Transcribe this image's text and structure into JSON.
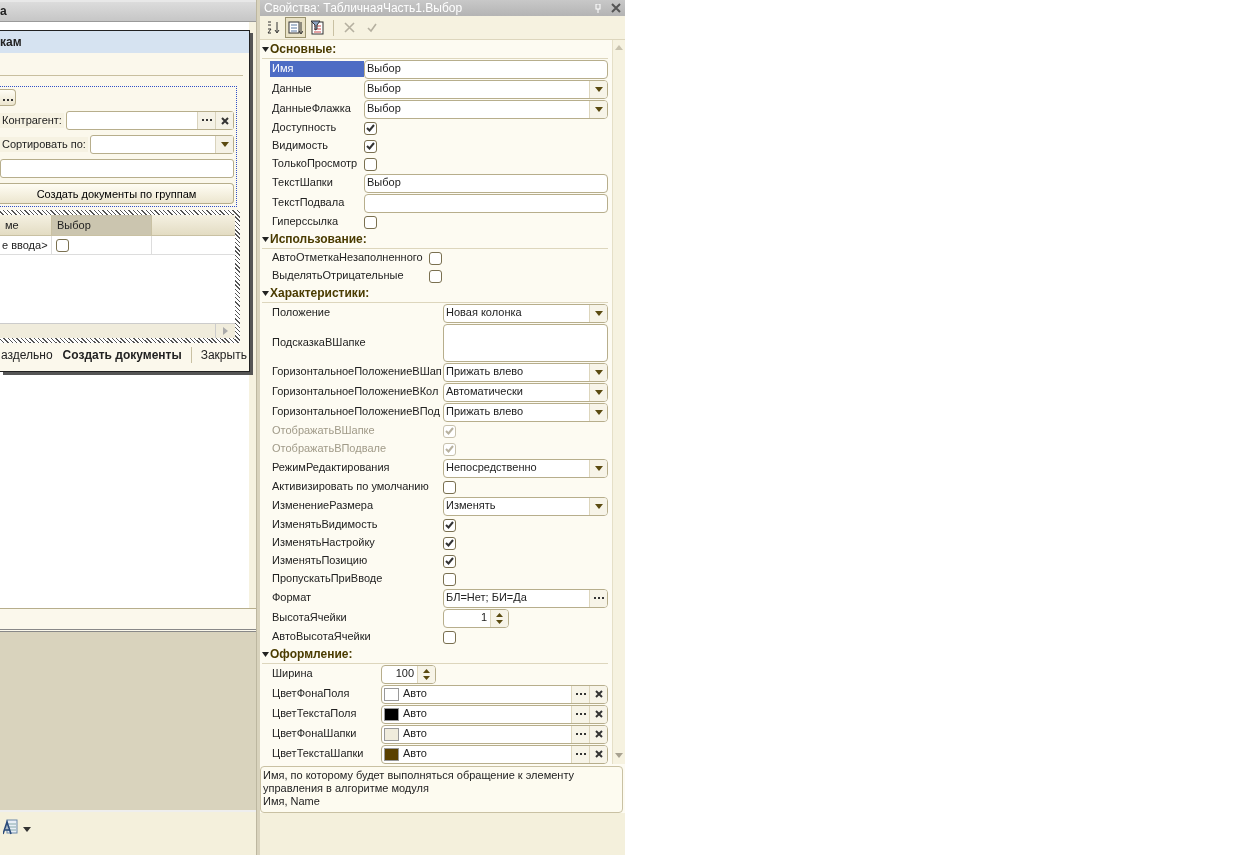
{
  "designer": {
    "title": "а",
    "form": {
      "title": "кам",
      "fields": [
        {
          "kind": "choice",
          "label": "Контрагент:"
        },
        {
          "kind": "select",
          "label": "Сортировать по:"
        },
        {
          "kind": "text"
        }
      ],
      "action_button": "Создать документы по группам",
      "table": {
        "columns": [
          {
            "title": "ме",
            "selected": false
          },
          {
            "title": "Выбор",
            "selected": true
          }
        ],
        "rows": [
          {
            "text": "е ввода>",
            "checked": false
          }
        ]
      },
      "buttons": [
        {
          "label": "аздельно",
          "default": false
        },
        {
          "label": "Создать документы",
          "default": true
        },
        {
          "label": "Закрыть",
          "default": false
        }
      ]
    }
  },
  "properties": {
    "title": "Свойства: ТабличнаяЧасть1.Выбор",
    "toolbar": [
      {
        "kind": "sort",
        "pressed": false,
        "disabled": false
      },
      {
        "kind": "categories",
        "pressed": true,
        "disabled": false
      },
      {
        "kind": "filter",
        "pressed": false,
        "disabled": false
      },
      {
        "kind": "delete",
        "pressed": false,
        "disabled": true
      },
      {
        "kind": "apply",
        "pressed": false,
        "disabled": true
      }
    ],
    "groups": [
      {
        "title": "Основные:",
        "expanded": true,
        "items": [
          {
            "label": "Имя",
            "kind": "text",
            "value": "Выбор",
            "selected": true
          },
          {
            "label": "Данные",
            "kind": "select",
            "value": "Выбор",
            "selected": false
          },
          {
            "label": "ДанныеФлажка",
            "kind": "select",
            "value": "Выбор",
            "selected": false
          },
          {
            "label": "Доступность",
            "kind": "check",
            "checked": true,
            "disabled": false,
            "selected": false
          },
          {
            "label": "Видимость",
            "kind": "check",
            "checked": true,
            "disabled": false,
            "selected": false
          },
          {
            "label": "ТолькоПросмотр",
            "kind": "check",
            "checked": false,
            "disabled": false,
            "selected": false
          },
          {
            "label": "ТекстШапки",
            "kind": "text",
            "value": "Выбор",
            "selected": false
          },
          {
            "label": "ТекстПодвала",
            "kind": "text",
            "selected": false
          },
          {
            "label": "Гиперссылка",
            "kind": "check",
            "checked": false,
            "disabled": false,
            "selected": false
          }
        ]
      },
      {
        "title": "Использование:",
        "expanded": true,
        "items": [
          {
            "label": "АвтоОтметкаНезаполненного",
            "kind": "check",
            "checked": false,
            "disabled": false,
            "selected": false
          },
          {
            "label": "ВыделятьОтрицательные",
            "kind": "check",
            "checked": false,
            "disabled": false,
            "selected": false
          }
        ]
      },
      {
        "title": "Характеристики:",
        "expanded": true,
        "items": [
          {
            "label": "Положение",
            "kind": "select",
            "value": "Новая колонка",
            "selected": false
          },
          {
            "label": "ПодсказкаВШапке",
            "kind": "textarea",
            "selected": false
          },
          {
            "label": "ГоризонтальноеПоложениеВШап",
            "kind": "select",
            "value": "Прижать влево",
            "selected": false
          },
          {
            "label": "ГоризонтальноеПоложениеВКол",
            "kind": "select",
            "value": "Автоматически",
            "selected": false
          },
          {
            "label": "ГоризонтальноеПоложениеВПод",
            "kind": "select",
            "value": "Прижать влево",
            "selected": false
          },
          {
            "label": "ОтображатьВШапке",
            "kind": "check",
            "checked": true,
            "disabled": true,
            "selected": false
          },
          {
            "label": "ОтображатьВПодвале",
            "kind": "check",
            "checked": true,
            "disabled": true,
            "selected": false
          },
          {
            "label": "РежимРедактирования",
            "kind": "select",
            "value": "Непосредственно",
            "selected": false
          },
          {
            "label": "Активизировать по умолчанию",
            "kind": "check",
            "checked": false,
            "disabled": false,
            "selected": false
          },
          {
            "label": "ИзменениеРазмера",
            "kind": "select",
            "value": "Изменять",
            "selected": false
          },
          {
            "label": "ИзменятьВидимость",
            "kind": "check",
            "checked": true,
            "disabled": false,
            "selected": false
          },
          {
            "label": "ИзменятьНастройку",
            "kind": "check",
            "checked": true,
            "disabled": false,
            "selected": false
          },
          {
            "label": "ИзменятьПозицию",
            "kind": "check",
            "checked": true,
            "disabled": false,
            "selected": false
          },
          {
            "label": "ПропускатьПриВводе",
            "kind": "check",
            "checked": false,
            "disabled": false,
            "selected": false
          },
          {
            "label": "Формат",
            "kind": "format",
            "value": "БЛ=Нет; БИ=Да",
            "selected": false
          },
          {
            "label": "ВысотаЯчейки",
            "kind": "spin",
            "value": "1",
            "selected": false
          },
          {
            "label": "АвтоВысотаЯчейки",
            "kind": "check",
            "checked": false,
            "disabled": false,
            "selected": false
          }
        ]
      },
      {
        "title": "Оформление:",
        "expanded": true,
        "items": [
          {
            "label": "Ширина",
            "kind": "spin",
            "value": "100",
            "selected": false
          },
          {
            "label": "ЦветФонаПоля",
            "kind": "color",
            "color": "#ffffff",
            "value": "Авто",
            "selected": false
          },
          {
            "label": "ЦветТекстаПоля",
            "kind": "color",
            "color": "#000000",
            "value": "Авто",
            "selected": false
          },
          {
            "label": "ЦветФонаШапки",
            "kind": "color",
            "color": "#f0ecdc",
            "value": "Авто",
            "selected": false
          },
          {
            "label": "ЦветТекстаШапки",
            "kind": "color",
            "color": "#5a4000",
            "value": "Авто",
            "selected": false
          }
        ]
      }
    ],
    "description": [
      "Имя, по которому будет выполняться обращение к элементу управления в алгоритме модуля",
      "Имя, Name"
    ]
  }
}
